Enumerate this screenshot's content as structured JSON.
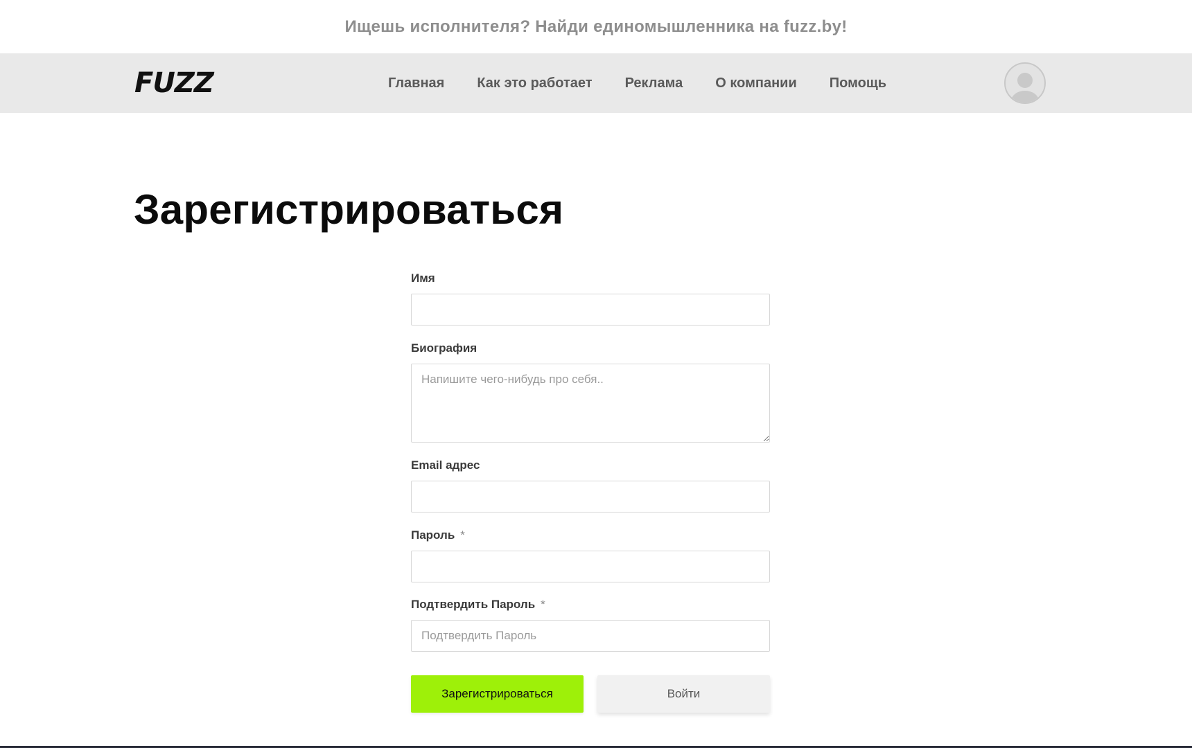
{
  "banner": {
    "text": "Ищешь исполнителя? Найди единомышленника на fuzz.by!"
  },
  "header": {
    "logo_text": "FUZZ",
    "nav": [
      {
        "label": "Главная"
      },
      {
        "label": "Как это работает"
      },
      {
        "label": "Реклама"
      },
      {
        "label": "О компании"
      },
      {
        "label": "Помощь"
      }
    ]
  },
  "main": {
    "title": "Зарегистрироваться",
    "form": {
      "name": {
        "label": "Имя",
        "value": "",
        "placeholder": ""
      },
      "bio": {
        "label": "Биография",
        "value": "",
        "placeholder": "Напишите чего-нибудь про себя.."
      },
      "email": {
        "label": "Email адрес",
        "value": "",
        "placeholder": ""
      },
      "password": {
        "label": "Пароль",
        "required_mark": "*",
        "value": "",
        "placeholder": ""
      },
      "confirm_password": {
        "label": "Подтвердить Пароль",
        "required_mark": "*",
        "value": "",
        "placeholder": "Подтвердить Пароль"
      },
      "register_button": "Зарегистрироваться",
      "login_button": "Войти"
    }
  },
  "colors": {
    "accent": "#9ef009",
    "navbar_bg": "#e9e9e9",
    "banner_text": "#8e8e8e",
    "nav_text": "#5a5a5a"
  }
}
